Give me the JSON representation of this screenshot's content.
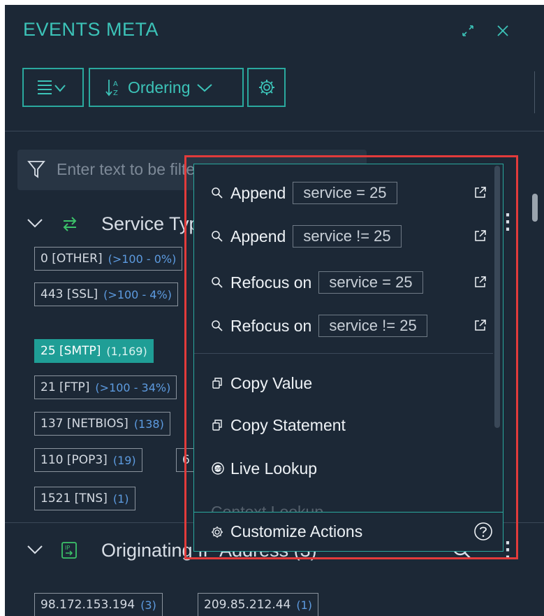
{
  "header": {
    "title": "EVENTS META"
  },
  "toolbar": {
    "ordering_label": "Ordering"
  },
  "filter": {
    "placeholder": "Enter text to be filtered"
  },
  "sections": [
    {
      "title": "Service Type"
    },
    {
      "title": "Originating IP Address (3)"
    }
  ],
  "service_values": [
    {
      "label": "0 [OTHER]",
      "count": "(>100 - 0%)"
    },
    {
      "label": "443 [SSL]",
      "count": "(>100 - 4%)"
    },
    {
      "label": "25 [SMTP]",
      "count": "(1,169)"
    },
    {
      "label": "21 [FTP]",
      "count": "(>100 - 34%)"
    },
    {
      "label": "137 [NETBIOS]",
      "count": "(138)"
    },
    {
      "label": "110 [POP3]",
      "count": "(19)"
    },
    {
      "label": "6",
      "count": ""
    },
    {
      "label": "1521 [TNS]",
      "count": "(1)"
    }
  ],
  "ip_values": [
    {
      "label": "98.172.153.194",
      "count": "(3)"
    },
    {
      "label": "209.85.212.44",
      "count": "(1)"
    }
  ],
  "menu": {
    "items": [
      {
        "action": "Append",
        "query": "service = 25"
      },
      {
        "action": "Append",
        "query": "service != 25"
      },
      {
        "action": "Refocus on",
        "query": "service = 25"
      },
      {
        "action": "Refocus on",
        "query": "service != 25"
      }
    ],
    "copy_value": "Copy Value",
    "copy_statement": "Copy Statement",
    "live_lookup": "Live Lookup",
    "context_lookup": "Context Lookup",
    "customize": "Customize Actions"
  },
  "colors": {
    "accent": "#3cc3b8",
    "panel_bg": "#1c2836",
    "count_blue": "#5d9be0",
    "highlight": "#e23b3b"
  }
}
